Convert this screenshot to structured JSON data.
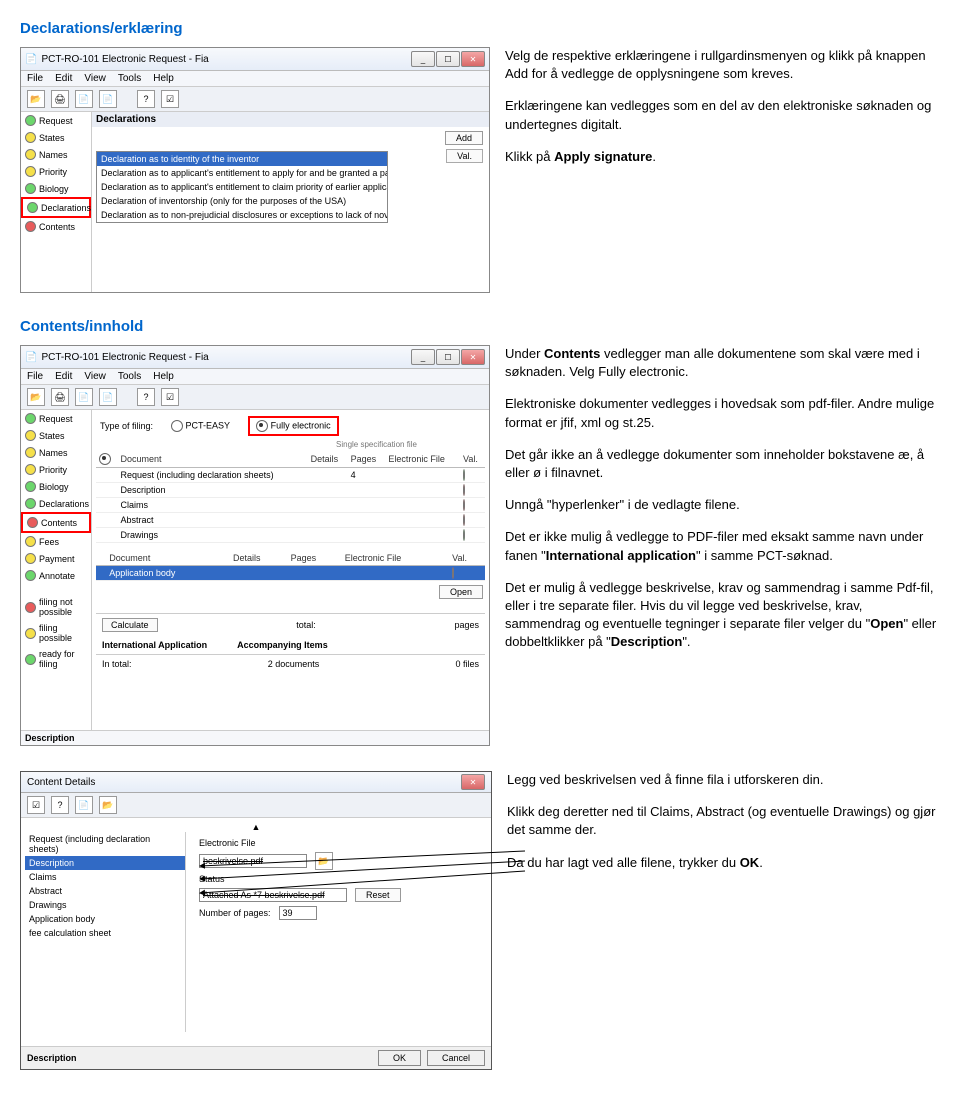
{
  "sections": {
    "declarations": {
      "title": "Declarations/erklæring",
      "para1": "Velg de respektive erklæringene i rullgardinsmenyen og klikk på knappen Add for å vedlegge de opplysningene som kreves.",
      "para2": "Erklæringene kan vedlegges som en del av den elektroniske søknaden og undertegnes digitalt.",
      "para3_a": "Klikk på ",
      "para3_b": "Apply signature",
      "para3_c": "."
    },
    "contents": {
      "title": "Contents/innhold",
      "para1_a": "Under ",
      "para1_b": "Contents",
      "para1_c": " vedlegger man alle dokumentene som skal være med i søknaden. Velg Fully electronic.",
      "para2": "Elektroniske dokumenter vedlegges i hovedsak som pdf-filer. Andre mulige format er jfif, xml og st.25.",
      "para3": "Det går ikke an å vedlegge dokumenter som inneholder bokstavene æ, å eller ø i filnavnet.",
      "para4": "Unngå \"hyperlenker\" i de vedlagte filene.",
      "para5_a": "Det er ikke mulig å vedlegge to PDF-filer med eksakt samme navn under fanen \"",
      "para5_b": "International application",
      "para5_c": "\" i samme PCT-søknad.",
      "para6_a": "Det er mulig å vedlegge beskrivelse, krav og sammendrag i samme Pdf-fil, eller i tre separate filer. Hvis du vil legge ved beskrivelse, krav, sammendrag og eventuelle tegninger i separate filer velger du \"",
      "para6_b": "Open",
      "para6_c": "\" eller dobbeltklikker på \"",
      "para6_d": "Description",
      "para6_e": "\"."
    },
    "attach": {
      "para1": "Legg ved beskrivelsen ved å finne fila i utforskeren din.",
      "para2": "Klikk deg deretter ned til Claims, Abstract (og eventuelle Drawings) og gjør det samme der.",
      "para3_a": "Da du har lagt ved alle filene, trykker du ",
      "para3_b": "OK",
      "para3_c": "."
    }
  },
  "window": {
    "title": "PCT-RO-101 Electronic Request - Fia",
    "menu": [
      "File",
      "Edit",
      "View",
      "Tools",
      "Help"
    ]
  },
  "sidebar_items": [
    "Request",
    "States",
    "Names",
    "Priority",
    "Biology",
    "Declarations",
    "Contents",
    "Fees",
    "Payment",
    "Annotate"
  ],
  "decl": {
    "header": "Declarations",
    "add": "Add",
    "val": "Val.",
    "selected": "Declaration as to identity of the inventor",
    "opts": [
      "Declaration as to applicant's entitlement to apply for and be granted a pate",
      "Declaration as to applicant's entitlement to claim priority of earlier applicat",
      "Declaration of inventorship (only for the purposes of the USA)",
      "Declaration as to non-prejudicial disclosures or exceptions to lack of nove"
    ]
  },
  "cont": {
    "filing_label": "Type of filing:",
    "opt_easy": "PCT-EASY",
    "opt_full": "Fully electronic",
    "opt_full_sub": "Single specification file",
    "cols": {
      "doc": "Document",
      "det": "Details",
      "pg": "Pages",
      "ef": "Electronic File",
      "val": "Val."
    },
    "rows1": [
      {
        "doc": "Request (including declaration sheets)",
        "det": "",
        "pg": "4"
      },
      {
        "doc": "Description"
      },
      {
        "doc": "Claims"
      },
      {
        "doc": "Abstract"
      },
      {
        "doc": "Drawings"
      }
    ],
    "app_body": "Application body",
    "open": "Open",
    "calc": "Calculate",
    "total": "total:",
    "pages": "pages",
    "st1": "filing not possible",
    "st2": "filing possible",
    "st3": "ready for filing",
    "intl": "International Application",
    "accomp": "Accompanying Items",
    "intotal": "In total:",
    "docs_n": "2",
    "docs": "documents",
    "files_n": "0",
    "files": "files",
    "desc": "Description"
  },
  "dlg": {
    "title": "Content Details",
    "list": [
      "Request (including declaration sheets)",
      "Description",
      "Claims",
      "Abstract",
      "Drawings",
      "Application body",
      "fee calculation sheet"
    ],
    "ef_label": "Electronic File",
    "ef_val": "beskrivelse.pdf",
    "status_label": "Status",
    "status_val": "Attached As *7 beskrivelse.pdf",
    "reset": "Reset",
    "np": "Number of pages:",
    "np_val": "39",
    "desc": "Description",
    "ok": "OK",
    "cancel": "Cancel"
  }
}
